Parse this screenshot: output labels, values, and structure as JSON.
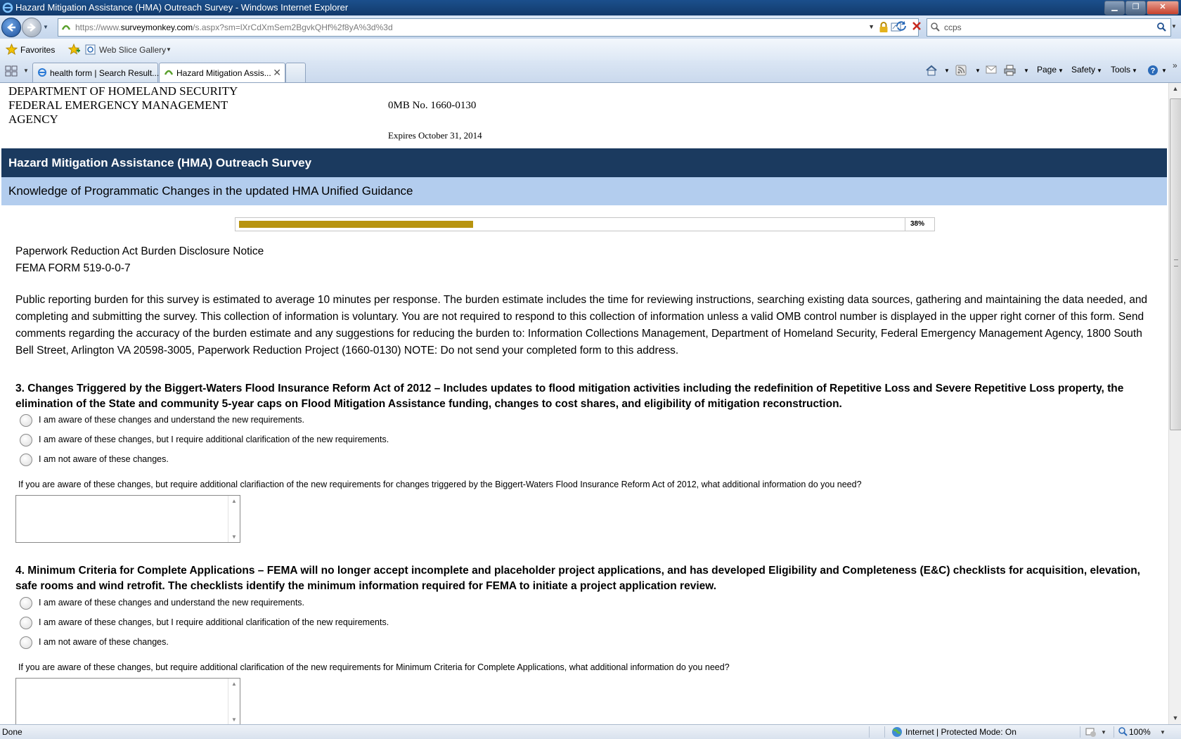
{
  "window": {
    "title": "Hazard Mitigation Assistance (HMA) Outreach Survey - Windows Internet Explorer",
    "minimize_glyph": "▁",
    "maximize_glyph": "❐",
    "close_glyph": "✕"
  },
  "address": {
    "url_prefix": "https://www.",
    "url_domain": "surveymonkey.com",
    "url_path": "/s.aspx?sm=lXrCdXmSem2BgvkQHf%2f8yA%3d%3d"
  },
  "search": {
    "value": "ccps"
  },
  "favorites_bar": {
    "favorites_label": "Favorites",
    "web_slice_label": "Web Slice Gallery"
  },
  "tabs": [
    {
      "label": "health form | Search Result..."
    },
    {
      "label": "Hazard Mitigation Assis..."
    }
  ],
  "commands": {
    "page": "Page",
    "safety": "Safety",
    "tools": "Tools"
  },
  "header": {
    "dept_line1": "DEPARTMENT OF HOMELAND SECURITY",
    "dept_line2": "FEDERAL EMERGENCY MANAGEMENT AGENCY",
    "omb": "0MB No. 1660-0130",
    "expires": "Expires October 31, 2014"
  },
  "survey": {
    "title": "Hazard Mitigation Assistance (HMA) Outreach Survey",
    "page_title": "Knowledge of Programmatic Changes in the updated HMA Unified Guidance",
    "progress_percent": 38,
    "progress_label": "38%"
  },
  "notice": {
    "heading": "Paperwork Reduction Act Burden Disclosure Notice",
    "form": "FEMA FORM 519-0-0-7",
    "body": "Public reporting burden for this survey is estimated to average 10 minutes per response. The burden estimate includes the time for reviewing instructions, searching existing data sources, gathering and maintaining the data needed, and completing and submitting the survey. This collection of information is voluntary. You are not required to respond to this collection of information unless a valid OMB control number is displayed in the upper right corner of this form. Send comments regarding the accuracy of the burden estimate and any suggestions for reducing the burden to: Information Collections Management, Department of Homeland Security, Federal Emergency Management Agency, 1800 South Bell Street, Arlington VA 20598-3005, Paperwork Reduction Project (1660-0130) NOTE: Do not send your completed form to this address."
  },
  "questions": [
    {
      "text": "3. Changes Triggered by the Biggert-Waters Flood Insurance Reform Act of 2012 – Includes updates to flood mitigation activities including the redefinition of Repetitive Loss and Severe Repetitive Loss property, the elimination of the State and community 5-year caps on Flood Mitigation Assistance funding, changes to cost shares, and eligibility of mitigation reconstruction.",
      "options": [
        "I am aware of these changes and understand the new requirements.",
        "I am aware of these changes, but I require additional clarification of the new requirements.",
        "I am not aware of these changes."
      ],
      "followup": "If you are aware of these changes, but require additional clarifiaction of the new requirements for changes triggered by the Biggert-Waters Flood Insurance Reform Act of 2012, what additional information do you need?"
    },
    {
      "text": "4. Minimum Criteria for Complete Applications – FEMA will no longer accept incomplete and placeholder project applications, and has developed Eligibility and Completeness (E&C) checklists for acquisition, elevation, safe rooms and wind retrofit. The checklists identify the minimum information required for FEMA to initiate a project application review.",
      "options": [
        "I am aware of these changes and understand the new requirements.",
        "I am aware of these changes, but I require additional clarification of the new requirements.",
        "I am not aware of these changes."
      ],
      "followup": "If you are aware of these changes, but require additional clarification of the new requirements for Minimum Criteria for Complete Applications, what additional information do you need?"
    }
  ],
  "status": {
    "text": "Done",
    "zone": "Internet | Protected Mode: On",
    "zoom": "100%"
  },
  "colors": {
    "survey_title_bg": "#1b3a5f",
    "page_title_bg": "#b3cdee",
    "progress_fill": "#b8940f"
  }
}
